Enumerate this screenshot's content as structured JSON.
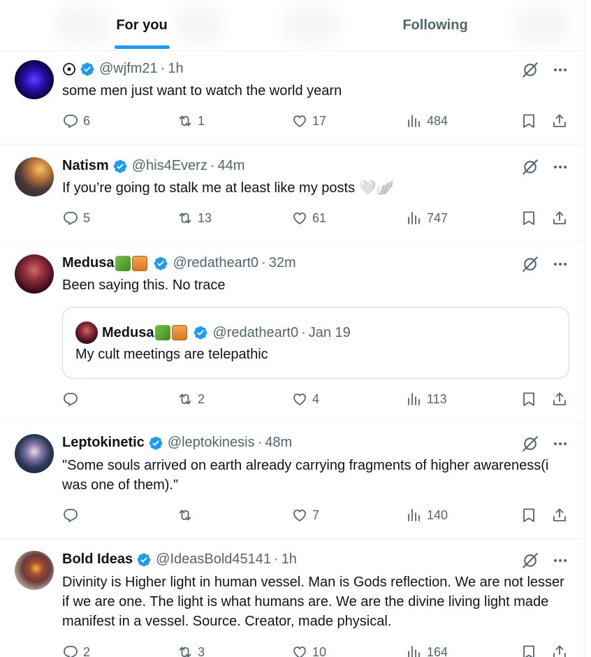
{
  "tabs": {
    "for_you": "For you",
    "following": "Following"
  },
  "posts": [
    {
      "name": "",
      "handle": "@wjfm21",
      "time": "1h",
      "text": "some men just want to watch the world yearn",
      "replies": "6",
      "reposts": "1",
      "likes": "17",
      "views": "484"
    },
    {
      "name": "Natism",
      "handle": "@his4Everz",
      "time": "44m",
      "text": "If you’re going to stalk me at least like my posts 🤍🪽",
      "replies": "5",
      "reposts": "13",
      "likes": "61",
      "views": "747"
    },
    {
      "name": "Medusa",
      "handle": "@redatheart0",
      "time": "32m",
      "text": "Been saying this. No trace",
      "replies": "",
      "reposts": "2",
      "likes": "4",
      "views": "113",
      "quote": {
        "name": "Medusa",
        "handle": "@redatheart0",
        "time": "Jan 19",
        "text": "My cult meetings are telepathic"
      }
    },
    {
      "name": "Leptokinetic",
      "handle": "@leptokinesis",
      "time": "48m",
      "text": "\"Some souls arrived on earth already carrying fragments of higher awareness(i was one of them).\"",
      "replies": "",
      "reposts": "",
      "likes": "7",
      "views": "140"
    },
    {
      "name": "Bold Ideas",
      "handle": "@IdeasBold45141",
      "time": "1h",
      "text": "Divinity is Higher light in human vessel.  Man is Gods reflection.  We are not lesser if we are one.  The light is what humans are.  We are the divine living light made manifest in a vessel.  Source.  Creator, made physical.",
      "replies": "2",
      "reposts": "3",
      "likes": "10",
      "views": "164"
    }
  ],
  "colors": {
    "accent": "#1d9bf0",
    "muted": "#536471",
    "text": "#0f1419",
    "border": "#eff3f4"
  }
}
